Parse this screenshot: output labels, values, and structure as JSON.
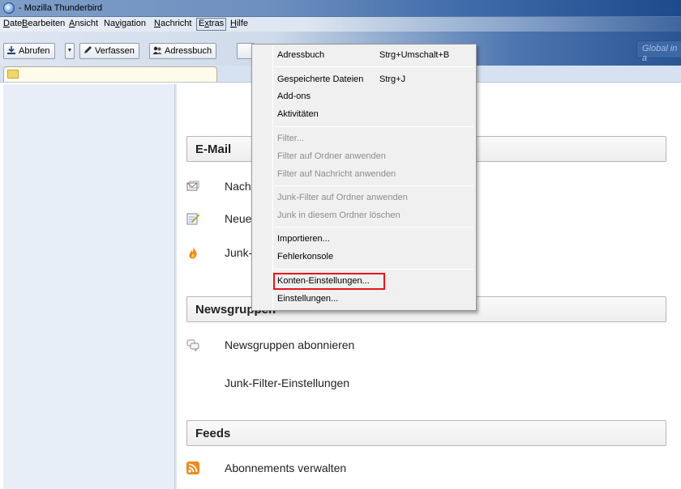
{
  "window": {
    "title": "- Mozilla Thunderbird"
  },
  "menubar": {
    "items": [
      {
        "label": "Datei",
        "mnemonic": "D",
        "rest": "atei"
      },
      {
        "label": "Bearbeiten",
        "mnemonic": "B",
        "rest": "earbeiten"
      },
      {
        "label": "Ansicht",
        "mnemonic": "A",
        "rest": "nsicht"
      },
      {
        "label": "Navigation",
        "pre": "Na",
        "mnemonic": "v",
        "rest": "igation"
      },
      {
        "label": "Nachricht",
        "mnemonic": "N",
        "rest": "achricht"
      },
      {
        "label": "Extras",
        "pre": "E",
        "mnemonic": "x",
        "rest": "tras"
      },
      {
        "label": "Hilfe",
        "mnemonic": "H",
        "rest": "ilfe"
      }
    ]
  },
  "toolbar": {
    "get_mail": "Abrufen",
    "compose": "Verfassen",
    "address_book": "Adressbuch"
  },
  "search": {
    "placeholder": "Global in a"
  },
  "sections": {
    "email": {
      "title": "E-Mail",
      "rows": [
        "Nach",
        "Neue",
        "Junk-"
      ]
    },
    "news": {
      "title": "Newsgruppen",
      "rows": [
        "Newsgruppen abonnieren",
        "Junk-Filter-Einstellungen"
      ]
    },
    "feeds": {
      "title": "Feeds",
      "rows": [
        "Abonnements verwalten"
      ]
    }
  },
  "extras_menu": {
    "items": [
      {
        "label": "Adressbuch",
        "shortcut": "Strg+Umschalt+B",
        "enabled": true
      },
      {
        "label": "Gespeicherte Dateien",
        "shortcut": "Strg+J",
        "enabled": true
      },
      {
        "label": "Add-ons",
        "enabled": true
      },
      {
        "label": "Aktivitäten",
        "enabled": true
      },
      {
        "label": "Filter...",
        "enabled": false
      },
      {
        "label": "Filter auf Ordner anwenden",
        "enabled": false
      },
      {
        "label": "Filter auf Nachricht anwenden",
        "enabled": false
      },
      {
        "label": "Junk-Filter auf Ordner anwenden",
        "enabled": false
      },
      {
        "label": "Junk in diesem Ordner löschen",
        "enabled": false
      },
      {
        "label": "Importieren...",
        "enabled": true
      },
      {
        "label": "Fehlerkonsole",
        "enabled": true
      },
      {
        "label": "Konten-Einstellungen...",
        "enabled": true,
        "highlighted": true
      },
      {
        "label": "Einstellungen...",
        "enabled": true
      }
    ]
  },
  "colors": {
    "highlight_border": "#e8141c",
    "menu_bg": "#f0f0f0",
    "folder_pane": "#e8eef8"
  },
  "icons": {
    "app": "thunderbird-icon",
    "get_mail": "download-icon",
    "compose": "pencil-icon",
    "address_book": "address-book-icon",
    "read_mail": "envelope-icon",
    "new_message": "compose-icon",
    "junk": "flame-icon",
    "newsgroups": "speech-bubbles-icon",
    "rss": "rss-feed-icon"
  }
}
